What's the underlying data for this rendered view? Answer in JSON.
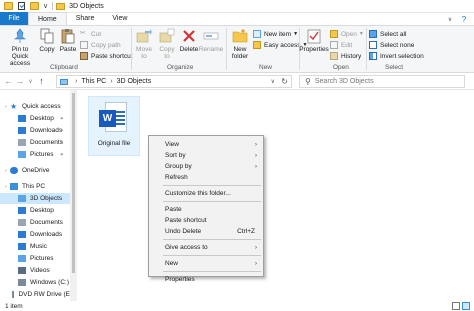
{
  "window": {
    "title": "3D Objects"
  },
  "ribbon_tabs": [
    "File",
    "Home",
    "Share",
    "View"
  ],
  "ribbon": {
    "clipboard": {
      "label": "Clipboard",
      "pin": "Pin to Quick access",
      "copy": "Copy",
      "paste": "Paste",
      "cut": "Cut",
      "copy_path": "Copy path",
      "paste_shortcut": "Paste shortcut"
    },
    "organize": {
      "label": "Organize",
      "move_to": "Move to",
      "copy_to": "Copy to",
      "delete": "Delete",
      "rename": "Rename"
    },
    "new": {
      "label": "New",
      "new_folder": "New folder",
      "new_item": "New item",
      "easy_access": "Easy access"
    },
    "open": {
      "label": "Open",
      "properties": "Properties",
      "open": "Open",
      "edit": "Edit",
      "history": "History"
    },
    "select": {
      "label": "Select",
      "select_all": "Select all",
      "select_none": "Select none",
      "invert": "Invert selection"
    }
  },
  "address": {
    "crumbs": [
      "This PC",
      "3D Objects"
    ],
    "search_placeholder": "Search 3D Objects"
  },
  "nav": {
    "items": [
      {
        "label": "Quick access",
        "level": 0,
        "icon": "star-icon",
        "color": "#2b7cd3"
      },
      {
        "label": "Desktop",
        "level": 1,
        "icon": "desktop-icon",
        "color": "#2b7cd3",
        "pinned": true
      },
      {
        "label": "Downloads",
        "level": 1,
        "icon": "download-icon",
        "color": "#2b7cd3",
        "pinned": true
      },
      {
        "label": "Documents",
        "level": 1,
        "icon": "documents-icon",
        "color": "#9aa5b1",
        "pinned": true
      },
      {
        "label": "Pictures",
        "level": 1,
        "icon": "pictures-icon",
        "color": "#5ba4e5",
        "pinned": true
      },
      {
        "label": "OneDrive",
        "level": 0,
        "icon": "cloud-icon",
        "color": "#2b7cd3"
      },
      {
        "label": "This PC",
        "level": 0,
        "icon": "pc-icon",
        "color": "#3c8fd8"
      },
      {
        "label": "3D Objects",
        "level": 1,
        "icon": "cube-icon",
        "color": "#5ba4e5",
        "selected": true
      },
      {
        "label": "Desktop",
        "level": 1,
        "icon": "desktop-icon",
        "color": "#2b7cd3"
      },
      {
        "label": "Documents",
        "level": 1,
        "icon": "documents-icon",
        "color": "#9aa5b1"
      },
      {
        "label": "Downloads",
        "level": 1,
        "icon": "download-icon",
        "color": "#2b7cd3"
      },
      {
        "label": "Music",
        "level": 1,
        "icon": "music-icon",
        "color": "#2b7cd3"
      },
      {
        "label": "Pictures",
        "level": 1,
        "icon": "pictures-icon",
        "color": "#5ba4e5"
      },
      {
        "label": "Videos",
        "level": 1,
        "icon": "videos-icon",
        "color": "#5b6c80"
      },
      {
        "label": "Windows (C:)",
        "level": 1,
        "icon": "drive-icon",
        "color": "#7a8a99"
      },
      {
        "label": "DVD RW Drive (E",
        "level": 1,
        "icon": "dvd-icon",
        "color": "#7a8a99"
      }
    ]
  },
  "files": [
    {
      "name": "Original file",
      "badge": "W"
    }
  ],
  "context_menu": {
    "items": [
      {
        "label": "View",
        "submenu": true
      },
      {
        "label": "Sort by",
        "submenu": true
      },
      {
        "label": "Group by",
        "submenu": true
      },
      {
        "label": "Refresh"
      },
      {
        "sep": true
      },
      {
        "label": "Customize this folder..."
      },
      {
        "sep": true
      },
      {
        "label": "Paste"
      },
      {
        "label": "Paste shortcut"
      },
      {
        "label": "Undo Delete",
        "shortcut": "Ctrl+Z"
      },
      {
        "sep": true
      },
      {
        "label": "Give access to",
        "submenu": true
      },
      {
        "sep": true
      },
      {
        "label": "New",
        "submenu": true
      },
      {
        "sep": true
      },
      {
        "label": "Properties"
      }
    ]
  },
  "status": {
    "count": "1 item"
  },
  "colors": {
    "accent": "#1979ca",
    "selection": "#cce8ff",
    "folder": "#f5c84c",
    "word": "#185abd"
  }
}
